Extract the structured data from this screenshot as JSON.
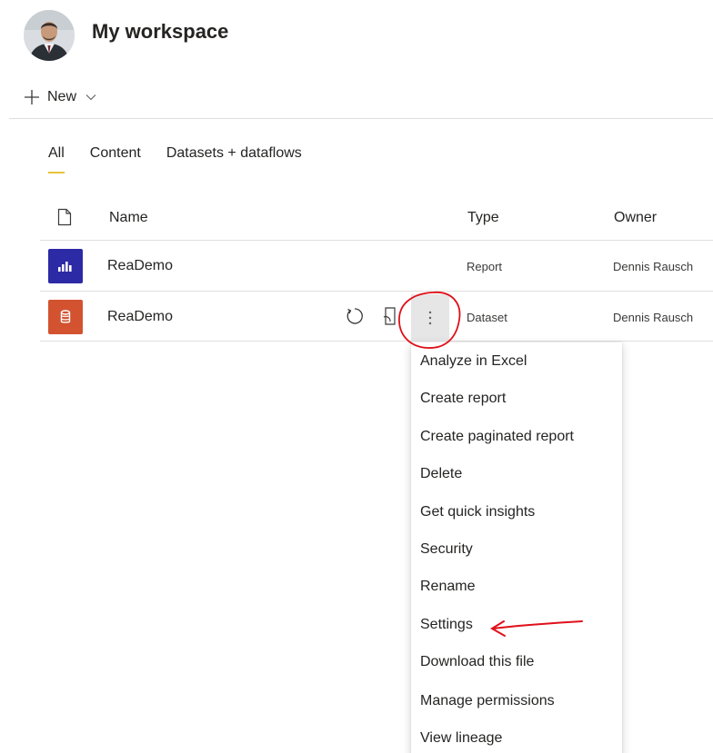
{
  "workspace": {
    "title": "My workspace"
  },
  "toolbar": {
    "new_label": "New"
  },
  "tabs": [
    {
      "label": "All",
      "active": true
    },
    {
      "label": "Content",
      "active": false
    },
    {
      "label": "Datasets + dataflows",
      "active": false
    }
  ],
  "table": {
    "columns": {
      "name": "Name",
      "type": "Type",
      "owner": "Owner"
    },
    "rows": [
      {
        "name": "ReaDemo",
        "type": "Report",
        "owner": "Dennis Rausch",
        "icon": "report-icon"
      },
      {
        "name": "ReaDemo",
        "type": "Dataset",
        "owner": "Dennis Rausch",
        "icon": "dataset-icon"
      }
    ]
  },
  "context_menu": {
    "items": [
      "Analyze in Excel",
      "Create report",
      "Create paginated report",
      "Delete",
      "Get quick insights",
      "Security",
      "Rename",
      "Settings",
      "Download this file",
      "Manage permissions",
      "View lineage"
    ]
  },
  "colors": {
    "report_tile": "#2d2aa6",
    "dataset_tile": "#d35230",
    "active_tab_underline": "#e8c33a",
    "annotation": "#e0101a"
  }
}
